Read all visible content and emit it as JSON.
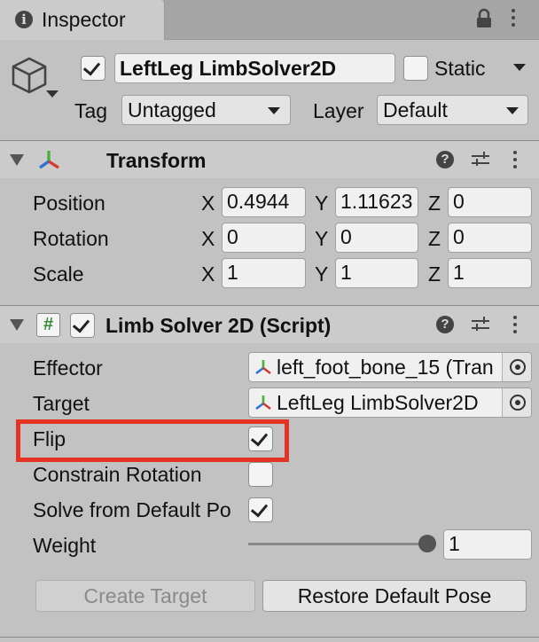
{
  "tab": {
    "title": "Inspector"
  },
  "object": {
    "name": "LeftLeg LimbSolver2D",
    "static_label": "Static",
    "tag_label": "Tag",
    "tag_value": "Untagged",
    "layer_label": "Layer",
    "layer_value": "Default"
  },
  "transform": {
    "title": "Transform",
    "rows": [
      {
        "label": "Position",
        "x": "0.4944",
        "y": "1.11623",
        "z": "0"
      },
      {
        "label": "Rotation",
        "x": "0",
        "y": "0",
        "z": "0"
      },
      {
        "label": "Scale",
        "x": "1",
        "y": "1",
        "z": "1"
      }
    ],
    "axes": [
      "X",
      "Y",
      "Z"
    ]
  },
  "solver": {
    "title": "Limb Solver 2D (Script)",
    "script_icon_char": "#",
    "effector_label": "Effector",
    "effector_value": "left_foot_bone_15 (Tran",
    "target_label": "Target",
    "target_value": "LeftLeg LimbSolver2D",
    "flip_label": "Flip",
    "flip_checked": true,
    "constrain_label": "Constrain Rotation",
    "constrain_checked": false,
    "solve_label": "Solve from Default Po",
    "solve_checked": true,
    "weight_label": "Weight",
    "weight_value": "1",
    "weight_fraction": 1.0,
    "create_target_label": "Create Target",
    "restore_pose_label": "Restore Default Pose"
  },
  "colors": {
    "highlight": "#e53323",
    "axis_red": "#d23b2e",
    "axis_green": "#4caf3c",
    "axis_blue": "#2f6fd6",
    "script_green": "#3a8a3a"
  },
  "icons": [
    "info-icon",
    "lock-icon",
    "kebab-menu-icon",
    "gameobject-cube-icon",
    "transform-axes-icon",
    "help-icon",
    "preset-sliders-icon",
    "script-icon",
    "target-circle-icon",
    "checkmark-icon",
    "foldout-arrow-icon"
  ]
}
